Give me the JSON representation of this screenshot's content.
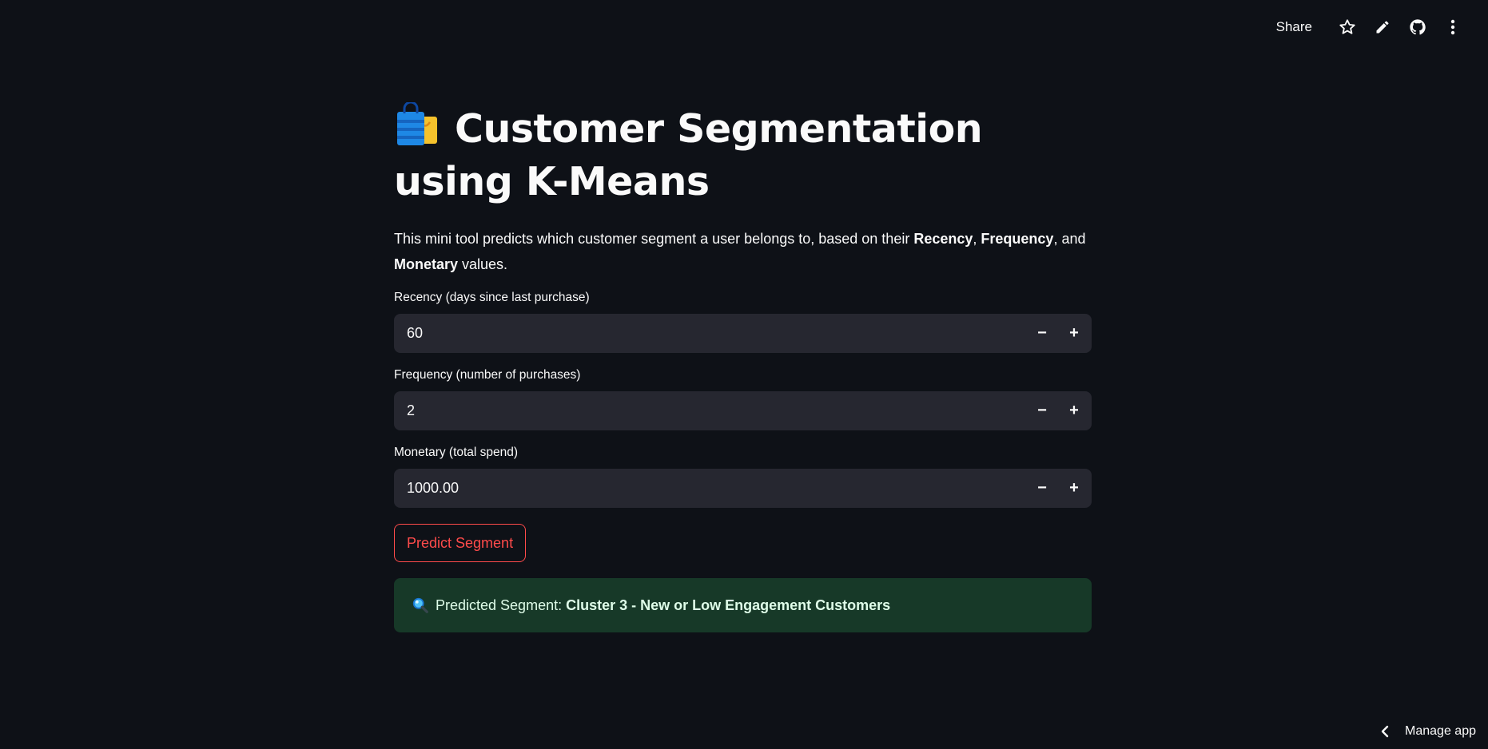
{
  "toolbar": {
    "share_label": "Share",
    "icons": [
      "star-icon",
      "pencil-icon",
      "github-icon",
      "more-vertical-icon"
    ]
  },
  "title": {
    "emoji": "shopping-bags-icon",
    "text": "Customer Segmentation using K-Means"
  },
  "intro": {
    "part1": "This mini tool predicts which customer segment a user belongs to, based on their ",
    "recency": "Recency",
    "sep1": ", ",
    "frequency": "Frequency",
    "part2": ", and ",
    "monetary": "Monetary",
    "part3": " values."
  },
  "fields": [
    {
      "label": "Recency (days since last purchase)",
      "value": "60"
    },
    {
      "label": "Frequency (number of purchases)",
      "value": "2"
    },
    {
      "label": "Monetary (total spend)",
      "value": "1000.00"
    }
  ],
  "stepper": {
    "minus": "−",
    "plus": "+"
  },
  "predict_button": "Predict Segment",
  "result": {
    "icon": "magnifier-icon",
    "prefix": "Predicted Segment:",
    "value": "Cluster 3 - New or Low Engagement Customers"
  },
  "footer": {
    "manage_app": "Manage app"
  },
  "colors": {
    "background": "#0e1117",
    "input_bg": "#262730",
    "primary": "#ff4b4b",
    "success_bg": "#173928",
    "text": "#fafafa"
  }
}
